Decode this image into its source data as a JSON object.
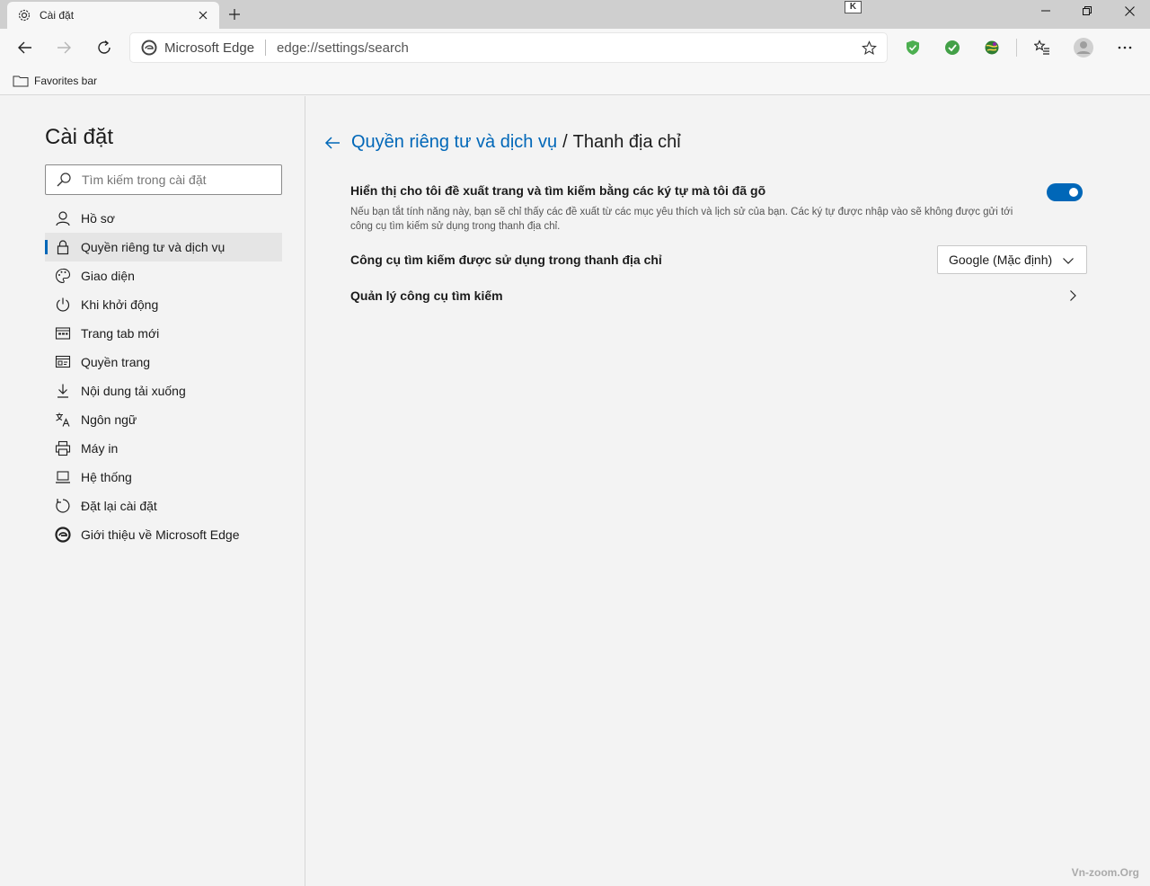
{
  "tab": {
    "title": "Cài đặt"
  },
  "titlebar": {
    "badge": "K"
  },
  "address": {
    "brand": "Microsoft Edge",
    "url": "edge://settings/search"
  },
  "favorites": {
    "label": "Favorites bar"
  },
  "sidebar": {
    "title": "Cài đặt",
    "search_placeholder": "Tìm kiếm trong cài đặt",
    "items": [
      {
        "label": "Hồ sơ",
        "icon": "person-icon"
      },
      {
        "label": "Quyền riêng tư và dịch vụ",
        "icon": "lock-icon",
        "active": true
      },
      {
        "label": "Giao diện",
        "icon": "palette-icon"
      },
      {
        "label": "Khi khởi động",
        "icon": "power-icon"
      },
      {
        "label": "Trang tab mới",
        "icon": "newtab-icon"
      },
      {
        "label": "Quyền trang",
        "icon": "site-permissions-icon"
      },
      {
        "label": "Nội dung tải xuống",
        "icon": "download-icon"
      },
      {
        "label": "Ngôn ngữ",
        "icon": "language-icon"
      },
      {
        "label": "Máy in",
        "icon": "printer-icon"
      },
      {
        "label": "Hệ thống",
        "icon": "laptop-icon"
      },
      {
        "label": "Đặt lại cài đặt",
        "icon": "reset-icon"
      },
      {
        "label": "Giới thiệu về Microsoft Edge",
        "icon": "edge-logo-icon"
      }
    ]
  },
  "main": {
    "breadcrumb_parent": "Quyền riêng tư và dịch vụ",
    "breadcrumb_sep": "/",
    "breadcrumb_current": "Thanh địa chỉ",
    "suggest_label": "Hiển thị cho tôi đề xuất trang và tìm kiếm bằng các ký tự mà tôi đã gõ",
    "suggest_desc": "Nếu bạn tắt tính năng này, bạn sẽ chỉ thấy các đề xuất từ các mục yêu thích và lịch sử của bạn. Các ký tự được nhập vào sẽ không được gửi tới công cụ tìm kiếm sử dụng trong thanh địa chỉ.",
    "suggest_enabled": true,
    "engine_label": "Công cụ tìm kiếm được sử dụng trong thanh địa chỉ",
    "engine_value": "Google (Mặc định)",
    "manage_label": "Quản lý công cụ tìm kiếm"
  },
  "watermark": "Vn-zoom.Org",
  "colors": {
    "accent": "#0067b8"
  }
}
